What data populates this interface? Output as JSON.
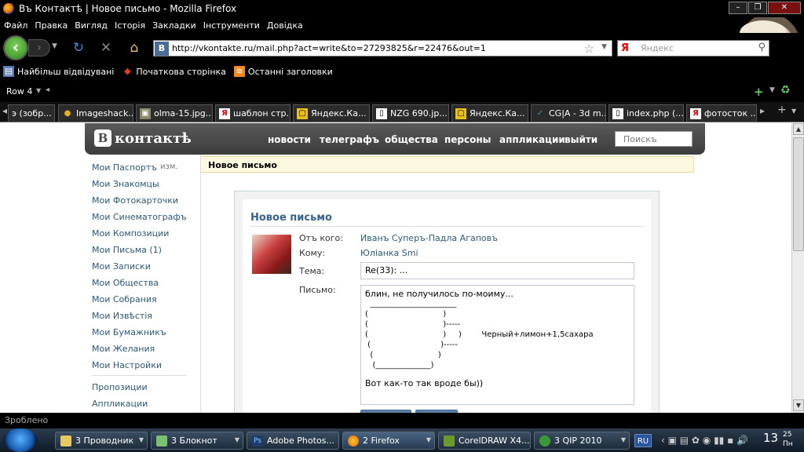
{
  "window": {
    "title": "Въ Контактѣ | Новое письмо - Mozilla Firefox"
  },
  "menubar": [
    "Файл",
    "Правка",
    "Вигляд",
    "Історія",
    "Закладки",
    "Інструменти",
    "Довідка"
  ],
  "navbar": {
    "url": "http://vkontakte.ru/mail.php?act=write&to=27293825&r=22476&out=1",
    "search_placeholder": "Яндекс",
    "search_engine": "Я"
  },
  "bookmarks": [
    {
      "label": "Найбільш відвідувані",
      "icon": "page-icon"
    },
    {
      "label": "Початкова сторінка",
      "icon": "firefox-icon"
    },
    {
      "label": "Останні заголовки",
      "icon": "rss-icon"
    }
  ],
  "rowbar": {
    "label": "Row 4"
  },
  "tabs": [
    {
      "label": "э (зобр...",
      "icon": "image-icon"
    },
    {
      "label": "Imageshack...",
      "icon": "frog-icon"
    },
    {
      "label": "olma-15.jpg...",
      "icon": "image-icon"
    },
    {
      "label": "шаблон стр...",
      "icon": "yandex-icon"
    },
    {
      "label": "Яндекс.Ка...",
      "icon": "yandex-card-icon"
    },
    {
      "label": "NZG 690.jp...",
      "icon": "page-icon"
    },
    {
      "label": "Яндекс.Ка...",
      "icon": "yandex-card-icon"
    },
    {
      "label": "CG|A - 3d m...",
      "icon": "cga-icon"
    },
    {
      "label": "index.php (...",
      "icon": "page-icon"
    },
    {
      "label": "фотосток ...",
      "icon": "yandex-icon"
    }
  ],
  "site": {
    "logo": "контактѣ",
    "logo_letter": "В",
    "nav": [
      "новости",
      "телеграфъ",
      "общества",
      "персоны",
      "аппликации",
      "выйти"
    ],
    "search_placeholder": "Поискъ"
  },
  "sidebar": {
    "items": [
      {
        "label": "Мои Паспортъ",
        "extra": "изм."
      },
      {
        "label": "Мои Знакомцы"
      },
      {
        "label": "Мои Фотокарточки"
      },
      {
        "label": "Мои Синематографъ"
      },
      {
        "label": "Мои Композиции"
      },
      {
        "label": "Мои Письма (1)"
      },
      {
        "label": "Мои Записки"
      },
      {
        "label": "Мои Общества"
      },
      {
        "label": "Мои Собрания"
      },
      {
        "label": "Мои Извѣстія"
      },
      {
        "label": "Мои Бумажникъ"
      },
      {
        "label": "Мои Желания"
      },
      {
        "label": "Мои Настройки"
      }
    ],
    "secondary": [
      "Пропозиции",
      "Аппликации"
    ]
  },
  "page": {
    "title": "Новое письмо"
  },
  "mail": {
    "heading": "Новое письмо",
    "from_label": "Отъ кого:",
    "from_value": "Иванъ Суперъ-Падла Агаповъ",
    "to_label": "Кому:",
    "to_value": "Юлiанка Smi",
    "subject_label": "Тема:",
    "subject_value": "Re(33):  ...",
    "body_label": "Письмо:",
    "body_line1": "блин, не получилось по-моиму...",
    "body_art": "  ______________________\n(                              )\n(                              )-----\n(                              )     )        Черный+лимон+1,5сахара\n (                            )-----\n  (                          )\n   (______________)",
    "body_line2": "Вот как-то так вроде бы))"
  },
  "statusbar": {
    "text": "Зроблено"
  },
  "taskbar": {
    "items": [
      {
        "label": "3 Проводник",
        "icon": "folder-icon"
      },
      {
        "label": "3 Блокнот",
        "icon": "notepad-icon"
      },
      {
        "label": "Adobe Photos...",
        "icon": "photoshop-icon"
      },
      {
        "label": "2 Firefox",
        "icon": "firefox-icon"
      },
      {
        "label": "CorelDRAW X4...",
        "icon": "coreldraw-icon"
      },
      {
        "label": "3 QIP 2010",
        "icon": "qip-icon"
      }
    ],
    "lang": "RU",
    "clock_hour": "13",
    "clock_min": "25",
    "clock_day": "Пн"
  }
}
